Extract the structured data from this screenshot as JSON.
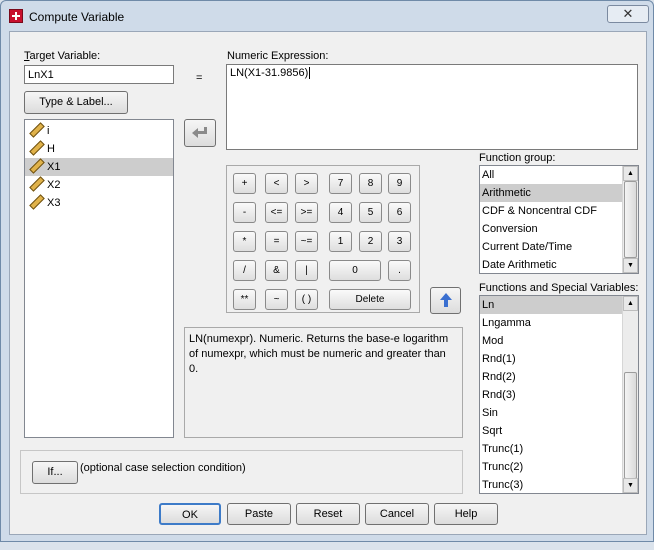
{
  "window": {
    "title": "Compute Variable",
    "close_glyph": "✕"
  },
  "target": {
    "label": "Target Variable:",
    "value": "LnX1",
    "equals": "=",
    "type_label_button": "Type & Label..."
  },
  "expression": {
    "label": "Numeric Expression:",
    "value": "LN(X1-31.9856)"
  },
  "variables": [
    {
      "name": "i",
      "selected": false
    },
    {
      "name": "H",
      "selected": false
    },
    {
      "name": "X1",
      "selected": true
    },
    {
      "name": "X2",
      "selected": false
    },
    {
      "name": "X3",
      "selected": false
    }
  ],
  "keypad": {
    "rows": [
      [
        "+",
        "<",
        ">",
        "7",
        "8",
        "9"
      ],
      [
        "-",
        "<=",
        ">=",
        "4",
        "5",
        "6"
      ],
      [
        "*",
        "=",
        "~=",
        "1",
        "2",
        "3"
      ],
      [
        "/",
        "&",
        "|",
        "0",
        "."
      ],
      [
        "**",
        "~",
        "( )",
        "Delete"
      ]
    ]
  },
  "description": "LN(numexpr). Numeric. Returns the base-e logarithm of numexpr, which must be numeric and greater than 0.",
  "function_group": {
    "label": "Function group:",
    "items": [
      "All",
      "Arithmetic",
      "CDF & Noncentral CDF",
      "Conversion",
      "Current Date/Time",
      "Date Arithmetic"
    ],
    "selected_index": 1
  },
  "functions": {
    "label": "Functions and Special Variables:",
    "items": [
      "Ln",
      "Lngamma",
      "Mod",
      "Rnd(1)",
      "Rnd(2)",
      "Rnd(3)",
      "Sin",
      "Sqrt",
      "Trunc(1)",
      "Trunc(2)",
      "Trunc(3)"
    ],
    "selected_index": 0
  },
  "if_section": {
    "button": "If...",
    "text": "(optional case selection condition)"
  },
  "buttons": {
    "ok": "OK",
    "paste": "Paste",
    "reset": "Reset",
    "cancel": "Cancel",
    "help": "Help"
  },
  "colors": {
    "accent_selection": "#cdcdcd",
    "up_arrow": "#3a6fd0"
  }
}
